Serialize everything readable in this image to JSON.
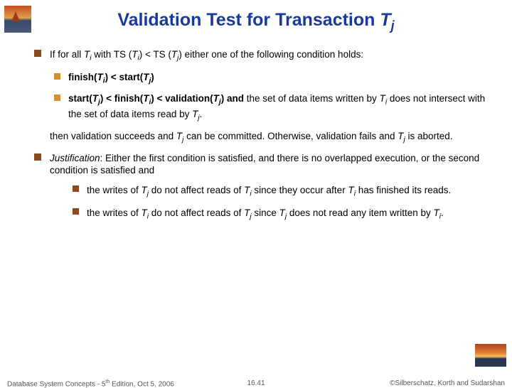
{
  "title": {
    "prefix": "Validation Test for Transaction ",
    "var": "T",
    "sub": "j"
  },
  "bullets": {
    "intro_a": "If for all ",
    "intro_b": " with TS (",
    "intro_c": ") < TS (",
    "intro_d": ") either one of the following condition holds:",
    "c1_a": "finish(",
    "c1_b": ") < start(",
    "c1_c": ")",
    "c2_a": "start(",
    "c2_b": ") < finish(",
    "c2_c": ") < validation(",
    "c2_d": ") and",
    "c2_e": " the set of data items written by ",
    "c2_f": " does not intersect with the set of data items read by ",
    "c2_g": ".",
    "then_a": "then validation succeeds and ",
    "then_b": " can be committed.  Otherwise, validation fails and ",
    "then_c": " is aborted.",
    "just_label": "Justification",
    "just_a": ":  Either the first condition is satisfied, and there is no overlapped execution, or the second condition is satisfied and",
    "sj1_a": "the writes of ",
    "sj1_b": " do not affect reads of ",
    "sj1_c": " since they occur after ",
    "sj1_d": " has finished its reads.",
    "sj2_a": "the writes of ",
    "sj2_b": " do not affect reads of ",
    "sj2_c": " since ",
    "sj2_d": " does not read any item written by ",
    "sj2_e": "."
  },
  "vars": {
    "T": "T",
    "i": "i",
    "j": "j"
  },
  "footer": {
    "left_a": "Database System Concepts - 5",
    "left_sup": "th",
    "left_b": " Edition, Oct 5, 2006",
    "center": "16.41",
    "right": "©Silberschatz, Korth and Sudarshan"
  }
}
